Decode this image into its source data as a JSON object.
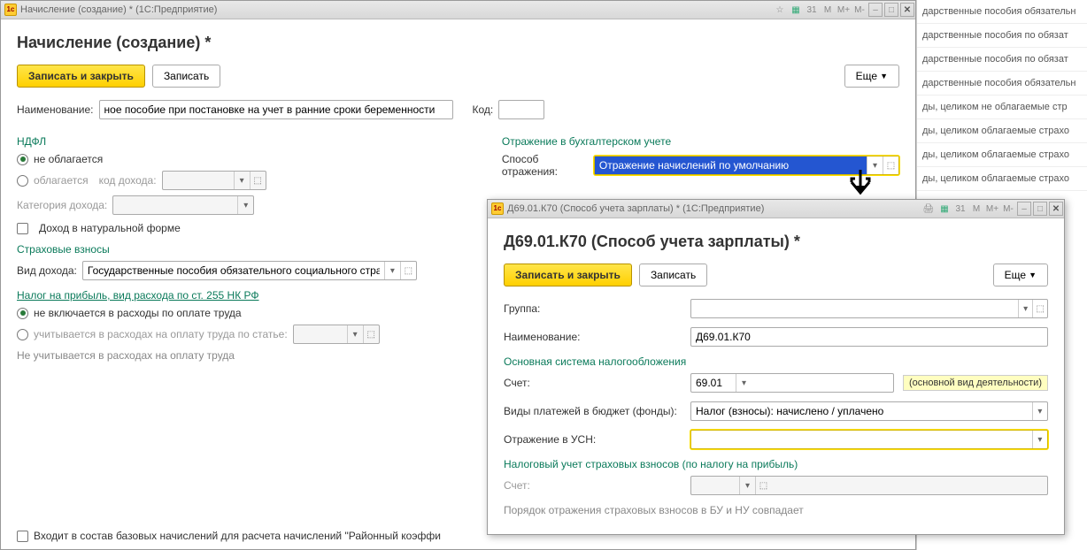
{
  "main": {
    "titlebar": "Начисление (создание) * (1С:Предприятие)",
    "title": "Начисление (создание) *",
    "save_close": "Записать и закрыть",
    "save": "Записать",
    "more": "Еще",
    "name_label": "Наименование:",
    "name_value": "ное пособие при постановке на учет в ранние сроки беременности",
    "code_label": "Код:",
    "ndfl": {
      "header": "НДФЛ",
      "not_taxed": "не облагается",
      "taxed": "облагается",
      "income_code": "код дохода:",
      "category": "Категория дохода:",
      "natural": "Доход в натуральной форме"
    },
    "accounting": {
      "header": "Отражение в бухгалтерском учете",
      "method_label": "Способ отражения:",
      "method_value": "Отражение начислений по умолчанию"
    },
    "insurance": {
      "header": "Страховые взносы",
      "income_type_label": "Вид дохода:",
      "income_type_value": "Государственные пособия обязательного социального страх"
    },
    "tax255": {
      "header": "Налог на прибыль, вид расхода по ст. 255 НК РФ",
      "not_included": "не включается в расходы по оплате труда",
      "included": "учитывается в расходах на оплату труда по статье:",
      "note": "Не учитывается в расходах на оплату труда"
    },
    "bottom_chk": "Входит в состав базовых начислений для расчета начислений \"Районный коэффи"
  },
  "sub": {
    "titlebar": "Д69.01.К70 (Способ учета зарплаты) * (1С:Предприятие)",
    "title": "Д69.01.К70 (Способ учета зарплаты) *",
    "save_close": "Записать и закрыть",
    "save": "Записать",
    "more": "Еще",
    "group": "Группа:",
    "name": "Наименование:",
    "name_value": "Д69.01.К70",
    "main_tax": "Основная система налогообложения",
    "account": "Счет:",
    "account_value": "69.01",
    "account_tag": "(основной вид деятельности)",
    "payment_types": "Виды платежей в бюджет (фонды):",
    "payment_value": "Налог (взносы): начислено / уплачено",
    "usn": "Отражение в УСН:",
    "insurance_tax": "Налоговый учет страховых взносов (по налогу на прибыль)",
    "account2": "Счет:",
    "footer": "Порядок отражения страховых взносов в БУ и НУ совпадает"
  },
  "side": [
    "дарственные пособия обязательн",
    "дарственные пособия по обязат",
    "дарственные пособия по обязат",
    "дарственные пособия обязательн",
    "ды, целиком не облагаемые стр",
    "ды, целиком облагаемые страхо",
    "ды, целиком облагаемые страхо",
    "ды, целиком облагаемые страхо"
  ]
}
